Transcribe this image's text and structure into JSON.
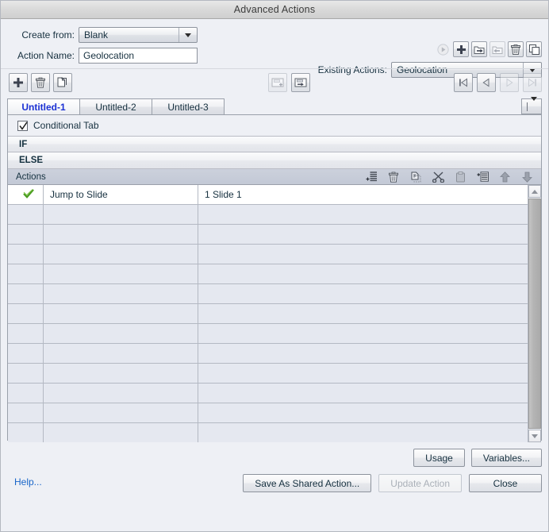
{
  "window": {
    "title": "Advanced Actions"
  },
  "form": {
    "create_from_label": "Create from:",
    "create_from_value": "Blank",
    "action_name_label": "Action Name:",
    "action_name_value": "Geolocation",
    "action_name_placeholder": "Action Name",
    "existing_actions_label": "Existing Actions:",
    "existing_actions_value": "Geolocation"
  },
  "top_toolbar": [
    {
      "name": "preview-action-button",
      "icon": "play-circle-icon",
      "disabled": true
    },
    {
      "name": "new-action-button",
      "icon": "plus-icon",
      "disabled": false
    },
    {
      "name": "export-action-button",
      "icon": "export-folder-icon",
      "disabled": false
    },
    {
      "name": "import-action-button",
      "icon": "import-folder-icon",
      "disabled": true
    },
    {
      "name": "delete-action-button",
      "icon": "trash-icon",
      "disabled": false
    },
    {
      "name": "duplicate-action-button",
      "icon": "copy-icon",
      "disabled": false
    }
  ],
  "tab_toolbar": {
    "left": [
      {
        "name": "add-tab-button",
        "icon": "plus-icon",
        "disabled": false
      },
      {
        "name": "delete-tab-button",
        "icon": "trash-icon",
        "disabled": false
      },
      {
        "name": "duplicate-tab-button",
        "icon": "copy-icon",
        "disabled": false
      }
    ],
    "middle": [
      {
        "name": "insert-decision-before-button",
        "icon": "decision-add-before-icon",
        "disabled": true
      },
      {
        "name": "insert-decision-after-button",
        "icon": "decision-add-after-icon",
        "disabled": false
      }
    ],
    "right": [
      {
        "name": "first-tab-button",
        "icon": "first-icon",
        "disabled": false
      },
      {
        "name": "previous-tab-button",
        "icon": "previous-icon",
        "disabled": false
      },
      {
        "name": "next-tab-button",
        "icon": "next-icon",
        "disabled": true
      },
      {
        "name": "last-tab-button",
        "icon": "last-icon",
        "disabled": true
      }
    ]
  },
  "tabs": {
    "items": [
      {
        "label": "Untitled-1",
        "active": true
      },
      {
        "label": "Untitled-2",
        "active": false
      },
      {
        "label": "Untitled-3",
        "active": false
      }
    ],
    "dropdown_icon": "chevron-down-icon"
  },
  "conditional": {
    "checkbox_checked": true,
    "label": "Conditional Tab",
    "if_label": "IF",
    "else_label": "ELSE"
  },
  "actions_panel": {
    "header_title": "Actions",
    "header_icons": [
      {
        "name": "add-action-button",
        "icon": "add-row-icon"
      },
      {
        "name": "delete-action-row-button",
        "icon": "trash-icon"
      },
      {
        "name": "copy-action-button",
        "icon": "copy-row-icon"
      },
      {
        "name": "cut-action-button",
        "icon": "scissors-icon"
      },
      {
        "name": "paste-action-button",
        "icon": "paste-icon"
      },
      {
        "name": "insert-action-button",
        "icon": "insert-row-icon"
      },
      {
        "name": "move-up-button",
        "icon": "arrow-up-icon"
      },
      {
        "name": "move-down-button",
        "icon": "arrow-down-icon"
      }
    ],
    "rows": [
      {
        "enabled": true,
        "action": "Jump to Slide",
        "parameter": "1 Slide 1"
      },
      {
        "enabled": false,
        "action": "",
        "parameter": ""
      },
      {
        "enabled": false,
        "action": "",
        "parameter": ""
      },
      {
        "enabled": false,
        "action": "",
        "parameter": ""
      },
      {
        "enabled": false,
        "action": "",
        "parameter": ""
      },
      {
        "enabled": false,
        "action": "",
        "parameter": ""
      },
      {
        "enabled": false,
        "action": "",
        "parameter": ""
      },
      {
        "enabled": false,
        "action": "",
        "parameter": ""
      },
      {
        "enabled": false,
        "action": "",
        "parameter": ""
      },
      {
        "enabled": false,
        "action": "",
        "parameter": ""
      },
      {
        "enabled": false,
        "action": "",
        "parameter": ""
      },
      {
        "enabled": false,
        "action": "",
        "parameter": ""
      },
      {
        "enabled": false,
        "action": "",
        "parameter": ""
      }
    ],
    "scrollbar": {
      "up_icon": "triangle-up-icon",
      "down_icon": "triangle-down-icon"
    }
  },
  "footer": {
    "help_label": "Help...",
    "usage_label": "Usage",
    "variables_label": "Variables...",
    "save_as_shared_label": "Save As Shared Action...",
    "update_action_label": "Update Action",
    "update_action_disabled": true,
    "close_label": "Close"
  },
  "colors": {
    "active_tab_text": "#1b31d4",
    "link": "#1a66c9",
    "checkmark_green": "#4a9c20",
    "panel_bg": "#eef0f5",
    "grid_row_empty": "#e5e8f0"
  }
}
